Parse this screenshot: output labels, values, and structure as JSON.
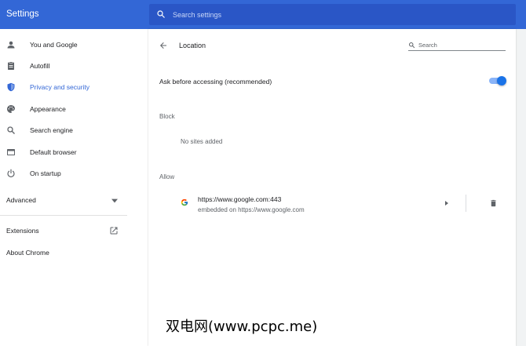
{
  "header": {
    "app_title": "Settings",
    "search_placeholder": "Search settings"
  },
  "sidebar": {
    "items": [
      {
        "label": "You and Google",
        "icon": "person-icon"
      },
      {
        "label": "Autofill",
        "icon": "clipboard-icon"
      },
      {
        "label": "Privacy and security",
        "icon": "shield-icon",
        "active": true
      },
      {
        "label": "Appearance",
        "icon": "palette-icon"
      },
      {
        "label": "Search engine",
        "icon": "search-icon"
      },
      {
        "label": "Default browser",
        "icon": "browser-icon"
      },
      {
        "label": "On startup",
        "icon": "power-icon"
      }
    ],
    "advanced_label": "Advanced",
    "extensions_label": "Extensions",
    "about_label": "About Chrome"
  },
  "content": {
    "page_title": "Location",
    "search_placeholder": "Search",
    "ask_setting_label": "Ask before accessing (recommended)",
    "ask_setting_enabled": true,
    "block_label": "Block",
    "block_empty": "No sites added",
    "allow_label": "Allow",
    "allowed_sites": [
      {
        "url": "https://www.google.com:443",
        "subtitle": "embedded on https://www.google.com",
        "icon": "google-g-icon"
      }
    ]
  },
  "watermark": "双电网(www.pcpc.me)",
  "colors": {
    "header_bg": "#3367d6",
    "accent": "#3367d6",
    "toggle_on": "#1a73e8"
  }
}
